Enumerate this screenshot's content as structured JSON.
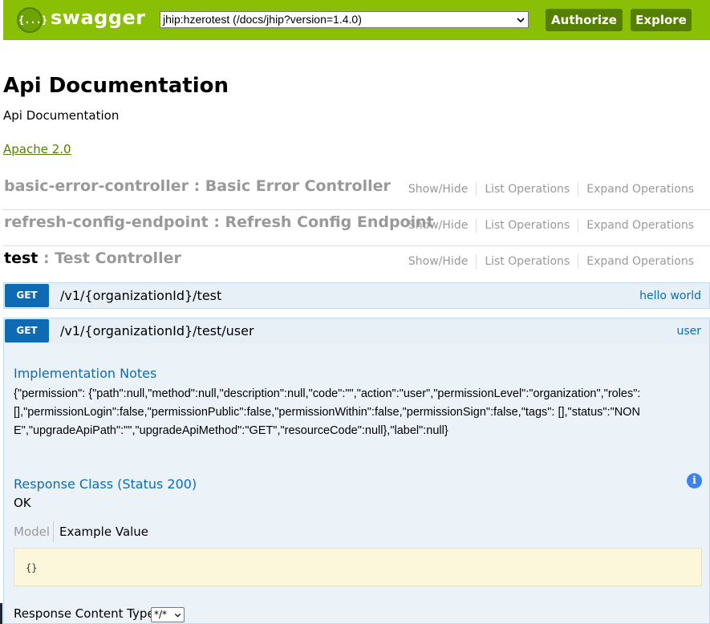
{
  "header": {
    "logo_glyph": "{...}",
    "brand": "swagger",
    "spec_select_value": "jhip:hzerotest (/docs/jhip?version=1.4.0)",
    "authorize_label": "Authorize",
    "explore_label": "Explore",
    "bar_color": "#89bf04",
    "button_color": "#547f00"
  },
  "info": {
    "title": "Api Documentation",
    "description": "Api Documentation",
    "license": "Apache 2.0"
  },
  "resources": [
    {
      "key": "basic-error-controller",
      "sep": " : ",
      "name": "Basic Error Controller"
    },
    {
      "key": "refresh-config-endpoint",
      "sep": " : ",
      "name": "Refresh Config Endpoint"
    },
    {
      "key": "test",
      "sep": " : ",
      "name": "Test Controller"
    }
  ],
  "resource_ops": {
    "show_hide": "Show/Hide",
    "list_operations": "List Operations",
    "expand_operations": "Expand Operations"
  },
  "operations": [
    {
      "method": "GET",
      "path": "/v1/{organizationId}/test",
      "summary": "hello world"
    },
    {
      "method": "GET",
      "path": "/v1/{organizationId}/test/user",
      "summary": "user"
    }
  ],
  "operation_detail": {
    "implementation_notes_heading": "Implementation Notes",
    "implementation_notes": "{\"permission\": {\"path\":null,\"method\":null,\"description\":null,\"code\":\"\",\"action\":\"user\",\"permissionLevel\":\"organization\",\"roles\": [],\"permissionLogin\":false,\"permissionPublic\":false,\"permissionWithin\":false,\"permissionSign\":false,\"tags\": [],\"status\":\"NONE\",\"upgradeApiPath\":\"\",\"upgradeApiMethod\":\"GET\",\"resourceCode\":null},\"label\":null}",
    "response_class_heading": "Response Class (Status 200)",
    "response_class_value": "OK",
    "tab_model": "Model",
    "tab_example": "Example Value",
    "example_value": "{}",
    "response_content_type_label": "Response Content Type",
    "response_content_type_value": "*/*"
  },
  "colors": {
    "get_method": "#0f6ab4",
    "op_background": "#e7f0f7",
    "example_background": "#fcf6db"
  }
}
